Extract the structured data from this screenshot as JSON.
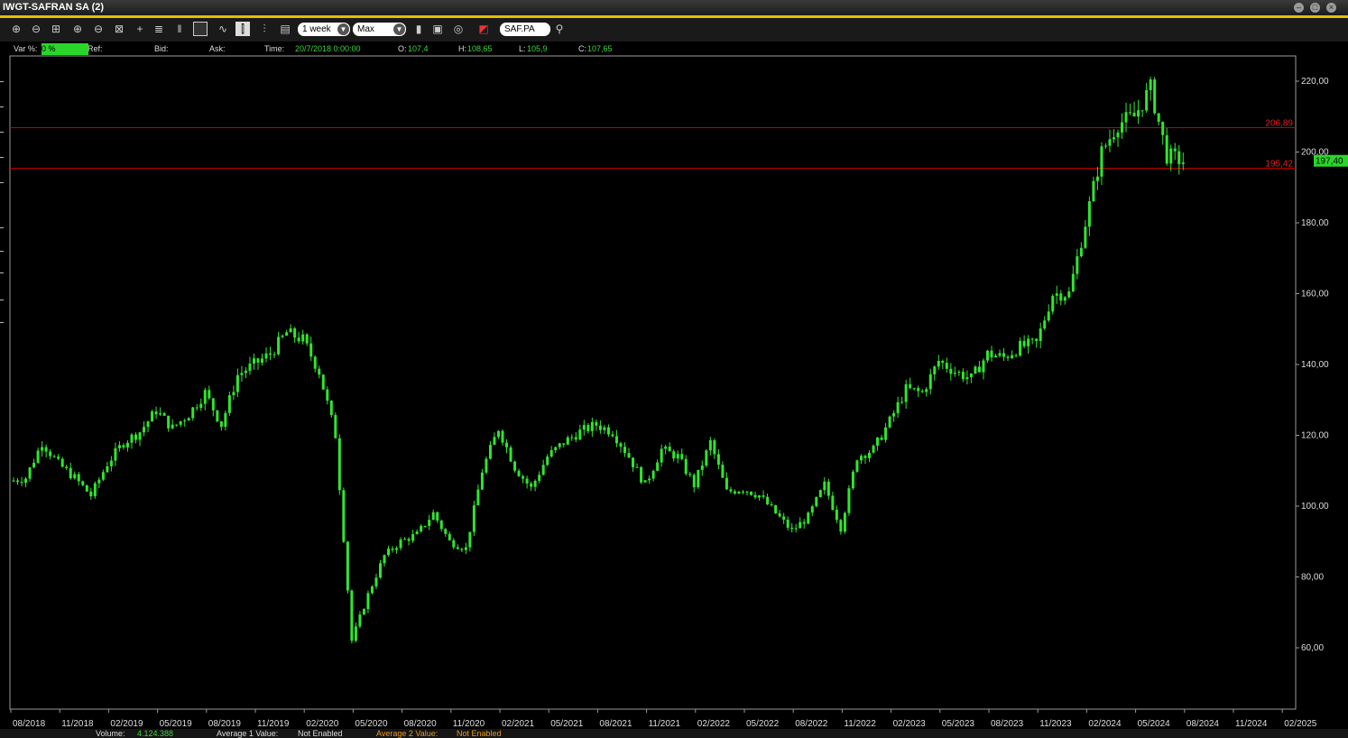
{
  "window": {
    "title": "IWGT-SAFRAN SA (2)"
  },
  "toolbar": {
    "period_value": "1 week",
    "range_value": "Max",
    "symbol_value": "SAF.PA"
  },
  "info": {
    "var_label": "Var %:",
    "var_value": "0 %",
    "ref_label": "Ref:",
    "bid_label": "Bid:",
    "ask_label": "Ask:",
    "time_label": "Time:",
    "time_value": "20/7/2018 0:00:00",
    "open_label": "O:",
    "open_value": "107,4",
    "high_label": "H:",
    "high_value": "108,65",
    "low_label": "L:",
    "low_value": "105,9",
    "close_label": "C:",
    "close_value": "107,65"
  },
  "bottom": {
    "volume_label": "Volume:",
    "volume_value": "4.124.388",
    "avg1_label": "Average 1 Value:",
    "avg1_value": "Not Enabled",
    "avg2_label": "Average 2 Value:",
    "avg2_value": "Not Enabled"
  },
  "colors": {
    "candle": "#2fe62f",
    "hline": "#c00000",
    "hline_label": "#e02020",
    "last_price_bg": "#2bd62b",
    "axis_text": "#dddddd"
  },
  "chart_data": {
    "type": "line",
    "title": "",
    "x_tick_labels": [
      "08/2018",
      "11/2018",
      "02/2019",
      "05/2019",
      "08/2019",
      "11/2019",
      "02/2020",
      "05/2020",
      "08/2020",
      "11/2020",
      "02/2021",
      "05/2021",
      "08/2021",
      "11/2021",
      "02/2022",
      "05/2022",
      "08/2022",
      "11/2022",
      "02/2023",
      "05/2023",
      "08/2023",
      "11/2023",
      "02/2024",
      "05/2024",
      "08/2024",
      "11/2024",
      "02/2025"
    ],
    "y_tick_labels": [
      "60,00",
      "80,00",
      "100,00",
      "120,00",
      "140,00",
      "160,00",
      "180,00",
      "200,00",
      "220,00"
    ],
    "ylim": [
      50,
      227
    ],
    "horizontal_lines": [
      {
        "value": 206.89,
        "label": "206,89"
      },
      {
        "value": 195.42,
        "label": "195,42"
      }
    ],
    "last_price": {
      "value": 197.4,
      "label": "197,40"
    },
    "series": [
      {
        "x": [
          "07/2018",
          "08/2018",
          "09/2018",
          "10/2018",
          "11/2018",
          "12/2018",
          "01/2019",
          "02/2019",
          "03/2019",
          "04/2019",
          "05/2019",
          "06/2019",
          "07/2019",
          "08/2019",
          "09/2019",
          "10/2019",
          "11/2019",
          "12/2019",
          "01/2020",
          "02/2020",
          "03/2020",
          "04/2020",
          "05/2020",
          "06/2020",
          "07/2020",
          "08/2020",
          "09/2020",
          "10/2020",
          "11/2020",
          "12/2020",
          "01/2021",
          "02/2021",
          "03/2021",
          "04/2021",
          "05/2021",
          "06/2021",
          "07/2021",
          "08/2021",
          "09/2021",
          "10/2021",
          "11/2021",
          "12/2021",
          "01/2022",
          "02/2022",
          "03/2022",
          "04/2022",
          "05/2022",
          "06/2022",
          "07/2022",
          "08/2022",
          "09/2022",
          "10/2022",
          "11/2022",
          "12/2022",
          "01/2023",
          "02/2023",
          "03/2023",
          "04/2023",
          "05/2023",
          "06/2023",
          "07/2023",
          "08/2023",
          "09/2023",
          "10/2023",
          "11/2023",
          "12/2023",
          "01/2024",
          "02/2024",
          "03/2024",
          "04/2024",
          "05/2024",
          "06/2024",
          "07/2024"
        ],
        "values": [
          107,
          108,
          118,
          112,
          108,
          103,
          112,
          118,
          121,
          127,
          122,
          126,
          132,
          123,
          137,
          140,
          143,
          149,
          147,
          138,
          120,
          62,
          75,
          86,
          90,
          92,
          98,
          90,
          88,
          110,
          122,
          111,
          105,
          114,
          118,
          121,
          123,
          121,
          114,
          106,
          116,
          114,
          106,
          118,
          104,
          105,
          103,
          98,
          93,
          97,
          106,
          94,
          114,
          116,
          124,
          133,
          132,
          141,
          138,
          136,
          143,
          142,
          145,
          146,
          160,
          160,
          180,
          200,
          208,
          210,
          218,
          199,
          197.4
        ]
      }
    ]
  }
}
